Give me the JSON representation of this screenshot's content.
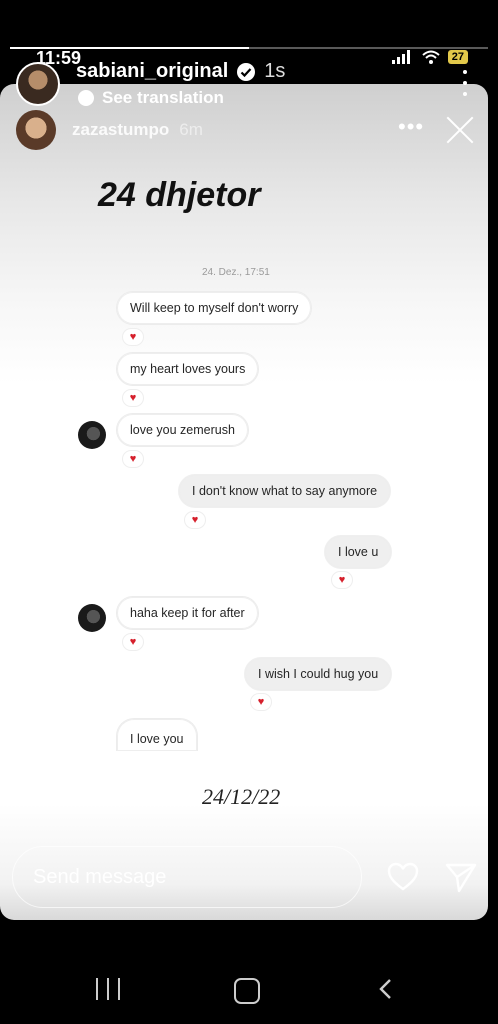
{
  "status_bar": {
    "time": "11:59",
    "battery": "27"
  },
  "story": {
    "progress": 0.5,
    "username": "sabiani_original",
    "time_ago": "1s",
    "see_translation": "See translation"
  },
  "repost": {
    "username": "zazastumpo",
    "time_ago": "6m",
    "heading": "24 dhjetor",
    "chat_date": "24. Dez., 17:51",
    "messages": [
      {
        "text": "Will keep to myself don't worry",
        "side": "left"
      },
      {
        "text": "my heart loves yours",
        "side": "left"
      },
      {
        "text": "love you zemerush",
        "side": "left"
      },
      {
        "text": "I don't know what to say anymore",
        "side": "right"
      },
      {
        "text": "I love u",
        "side": "right"
      },
      {
        "text": "haha keep it for after",
        "side": "left"
      },
      {
        "text": "I wish I could hug you",
        "side": "right"
      },
      {
        "text": "I love you",
        "side": "left"
      }
    ],
    "reaction": "♥",
    "signature": "24/12/22"
  },
  "composer": {
    "placeholder": "Send message"
  },
  "icons": [
    "verified-badge-icon",
    "signal-icon",
    "wifi-icon",
    "battery-icon",
    "more-options-icon",
    "translate-bubble-icon",
    "close-icon",
    "heart-icon",
    "send-icon",
    "recents-icon",
    "home-icon",
    "back-icon"
  ]
}
